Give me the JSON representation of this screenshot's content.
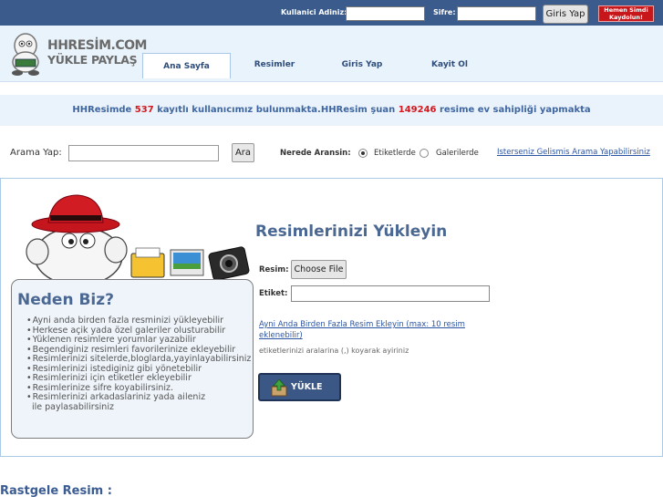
{
  "login": {
    "username_label": "Kullanici Adiniz:",
    "password_label": "Sifre:",
    "login_button": "Giris Yap",
    "register_line1": "Hemen Simdi",
    "register_line2": "Kaydolun!"
  },
  "logo": {
    "line1": "HHRESİM.COM",
    "line2": "YÜKLE PAYLAŞ"
  },
  "nav": {
    "tabs": [
      {
        "label": "Ana Sayfa"
      },
      {
        "label": "Resimler"
      },
      {
        "label": "Giris Yap"
      },
      {
        "label": "Kayit Ol"
      }
    ]
  },
  "stats": {
    "part1": "HHResimde ",
    "users": "537",
    "part2": " kayıtlı kullanıcımız bulunmakta.HHResim şuan ",
    "images": "149246",
    "part3": " resime ev sahipliği yapmakta"
  },
  "search": {
    "label": "Arama Yap:",
    "button": "Ara",
    "where_label": "Nerede Aransin:",
    "option1": "Etiketlerde",
    "option2": "Galerilerde",
    "advanced_link": "Isterseniz Gelismis Arama Yapabilirsiniz"
  },
  "why": {
    "title": "Neden Biz?",
    "items": [
      "Ayni anda birden fazla resminizi yükleyebilir",
      "Herkese açik yada özel galeriler olusturabilir",
      "Yüklenen resimlere yorumlar yazabilir",
      "Begendiginiz resimleri favorilerinize ekleyebilir",
      "Resimlerinizi sitelerde,bloglarda,yayinlayabilirsiniz",
      "Resimlerinizi istediginiz gibi yönetebilir",
      "Resimlerinizi için etiketler ekleyebilir",
      "Resimlerinize sifre koyabilirsiniz.",
      "Resimlerinizi arkadaslariniz yada aileniz"
    ],
    "items_cont": "ile paylasabilirsiniz"
  },
  "upload": {
    "title": "Resimlerinizi Yükleyin",
    "image_label": "Resim:",
    "choose_button": "Choose File",
    "tag_label": "Etiket:",
    "multi_link": "Ayni Anda Birden Fazla Resim Ekleyin (max: 10 resim eklenebilir)",
    "hint": "etiketlerinizi aralarina (,) koyarak ayiriniz",
    "upload_button": "YÜKLE"
  },
  "random": {
    "title": "Rastgele Resim :"
  },
  "colors": {
    "topbar": "#3a5b8c",
    "accent_red": "#d4181e",
    "link_blue": "#2b55a3",
    "heading_blue": "#4b6892"
  }
}
